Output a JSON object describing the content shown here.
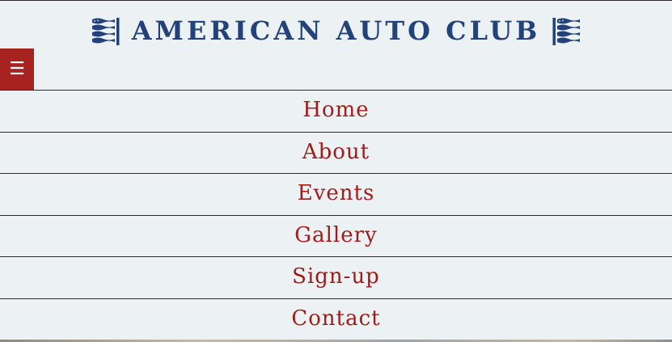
{
  "header": {
    "title": "AMERICAN AUTO CLUB",
    "left_icon": "flag-icon",
    "right_icon": "flag-icon"
  },
  "menu_toggle": {
    "label": "☰",
    "icon": "hamburger-icon"
  },
  "nav": {
    "items": [
      {
        "label": "Home"
      },
      {
        "label": "About"
      },
      {
        "label": "Events"
      },
      {
        "label": "Gallery"
      },
      {
        "label": "Sign-up"
      },
      {
        "label": "Contact"
      }
    ]
  },
  "colors": {
    "background": "#ecf1f4",
    "title": "#24427a",
    "nav_link": "#a01c1a",
    "menu_button": "#a6231f"
  }
}
